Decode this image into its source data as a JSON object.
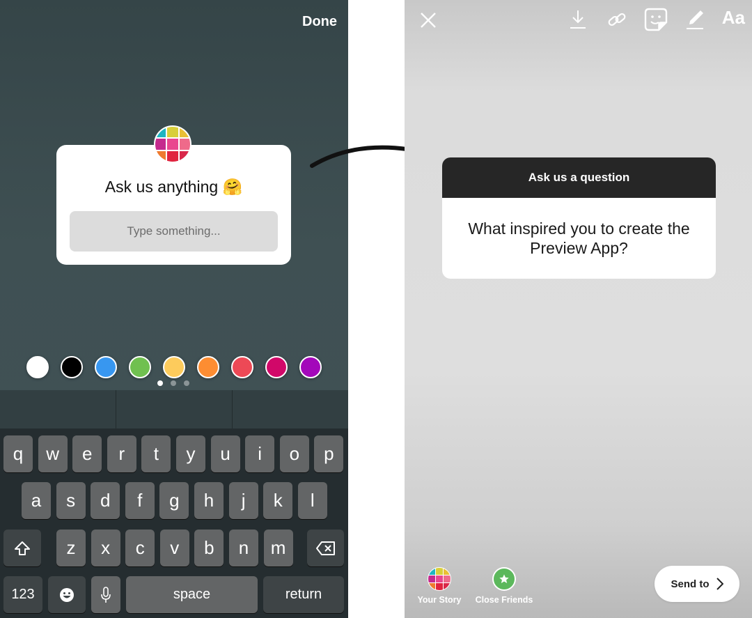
{
  "left_panel": {
    "done_label": "Done",
    "sticker": {
      "title": "Ask us anything 🤗",
      "input_placeholder": "Type something...",
      "avatar_colors": [
        "#1fb5c1",
        "#d8cf3a",
        "#e9bf35",
        "#c52a8e",
        "#e9468f",
        "#ef6a8a",
        "#ef7a2e",
        "#e0243f",
        "#d9284a"
      ]
    },
    "color_palette": [
      "#ffffff",
      "#000000",
      "#3897f0",
      "#70c050",
      "#fdcb5c",
      "#fd8d32",
      "#ed4956",
      "#d10869",
      "#a307ba"
    ],
    "page_dots": {
      "count": 3,
      "active": 1
    },
    "keyboard": {
      "row1": [
        "q",
        "w",
        "e",
        "r",
        "t",
        "y",
        "u",
        "i",
        "o",
        "p"
      ],
      "row2": [
        "a",
        "s",
        "d",
        "f",
        "g",
        "h",
        "j",
        "k",
        "l"
      ],
      "row3": [
        "z",
        "x",
        "c",
        "v",
        "b",
        "n",
        "m"
      ],
      "shift_icon": "shift-icon",
      "delete_icon": "delete-icon",
      "numbers_label": "123",
      "emoji_icon": "emoji-icon",
      "mic_icon": "microphone-icon",
      "space_label": "space",
      "return_label": "return"
    }
  },
  "right_panel": {
    "toolbar": {
      "close_icon": "close-icon",
      "download_icon": "download-icon",
      "link_icon": "link-icon",
      "sticker_icon": "sticker-icon",
      "draw_icon": "pen-icon",
      "text_label": "Aa"
    },
    "question_card": {
      "header": "Ask us a question",
      "question": "What inspired you to create the Preview App?"
    },
    "share": {
      "your_story_label": "Your Story",
      "close_friends_label": "Close Friends",
      "close_friends_color": "#5cb85c",
      "send_to_label": "Send to"
    }
  }
}
